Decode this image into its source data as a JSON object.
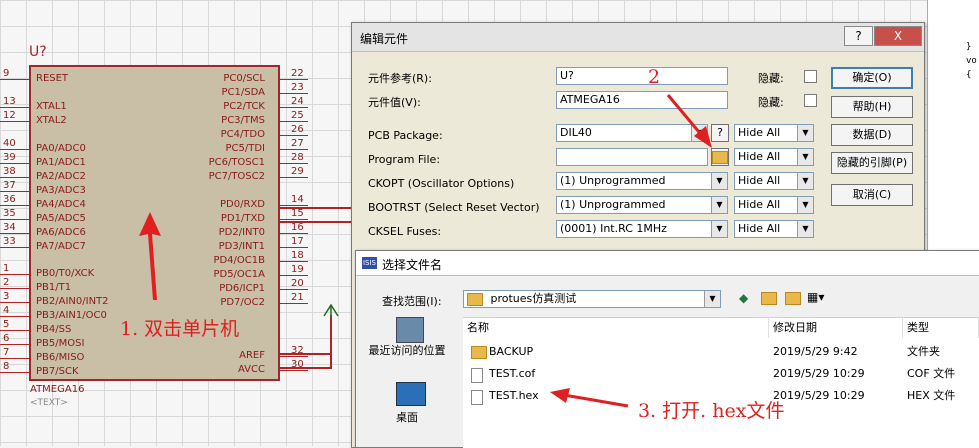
{
  "schematic": {
    "chip_ref": "U?",
    "chip_name": "ATMEGA16",
    "chip_text": "<TEXT>",
    "left_pins": [
      {
        "num": "9",
        "label": "RESET"
      },
      {
        "num": "13",
        "label": "XTAL1"
      },
      {
        "num": "12",
        "label": "XTAL2"
      },
      {
        "num": "40",
        "label": "PA0/ADC0"
      },
      {
        "num": "39",
        "label": "PA1/ADC1"
      },
      {
        "num": "38",
        "label": "PA2/ADC2"
      },
      {
        "num": "37",
        "label": "PA3/ADC3"
      },
      {
        "num": "36",
        "label": "PA4/ADC4"
      },
      {
        "num": "35",
        "label": "PA5/ADC5"
      },
      {
        "num": "34",
        "label": "PA6/ADC6"
      },
      {
        "num": "33",
        "label": "PA7/ADC7"
      },
      {
        "num": "1",
        "label": "PB0/T0/XCK"
      },
      {
        "num": "2",
        "label": "PB1/T1"
      },
      {
        "num": "3",
        "label": "PB2/AIN0/INT2"
      },
      {
        "num": "4",
        "label": "PB3/AIN1/OC0"
      },
      {
        "num": "5",
        "label": "PB4/SS"
      },
      {
        "num": "6",
        "label": "PB5/MOSI"
      },
      {
        "num": "7",
        "label": "PB6/MISO"
      },
      {
        "num": "8",
        "label": "PB7/SCK"
      }
    ],
    "right_pins": [
      {
        "num": "22",
        "label": "PC0/SCL"
      },
      {
        "num": "23",
        "label": "PC1/SDA"
      },
      {
        "num": "24",
        "label": "PC2/TCK"
      },
      {
        "num": "25",
        "label": "PC3/TMS"
      },
      {
        "num": "26",
        "label": "PC4/TDO"
      },
      {
        "num": "27",
        "label": "PC5/TDI"
      },
      {
        "num": "28",
        "label": "PC6/TOSC1"
      },
      {
        "num": "29",
        "label": "PC7/TOSC2"
      },
      {
        "num": "14",
        "label": "PD0/RXD"
      },
      {
        "num": "15",
        "label": "PD1/TXD"
      },
      {
        "num": "16",
        "label": "PD2/INT0"
      },
      {
        "num": "17",
        "label": "PD3/INT1"
      },
      {
        "num": "18",
        "label": "PD4/OC1B"
      },
      {
        "num": "19",
        "label": "PD5/OC1A"
      },
      {
        "num": "20",
        "label": "PD6/ICP1"
      },
      {
        "num": "21",
        "label": "PD7/OC2"
      },
      {
        "num": "32",
        "label": "AREF"
      },
      {
        "num": "30",
        "label": "AVCC"
      }
    ]
  },
  "annotations": {
    "step1": "1. 双击单片机",
    "step2": "2",
    "step3": "3. 打开. hex文件"
  },
  "edit_dialog": {
    "title": "编辑元件",
    "help_btn": "?",
    "close_btn": "X",
    "ref_label": "元件参考(R):",
    "ref_value": "U?",
    "value_label": "元件值(V):",
    "value_value": "ATMEGA16",
    "hidden_label1": "隐藏:",
    "hidden_label2": "隐藏:",
    "pcb_label": "PCB Package:",
    "pcb_value": "DIL40",
    "pcb_btn": "?",
    "program_label": "Program File:",
    "ckopt_label": "CKOPT (Oscillator Options)",
    "ckopt_value": "(1) Unprogrammed",
    "bootrst_label": "BOOTRST (Select Reset Vector)",
    "bootrst_value": "(1) Unprogrammed",
    "cksel_label": "CKSEL Fuses:",
    "cksel_value": "(0001) Int.RC 1MHz",
    "hide_all": "Hide All",
    "buttons": {
      "ok": "确定(O)",
      "help": "帮助(H)",
      "data": "数据(D)",
      "hidden_pins": "隐藏的引脚(P)",
      "cancel": "取消(C)"
    }
  },
  "file_dialog": {
    "app_icon": "ISIS",
    "title": "选择文件名",
    "lookin_label": "查找范围(I):",
    "lookin_value": "protues仿真测试",
    "places": [
      {
        "label": "最近访问的位置"
      },
      {
        "label": "桌面"
      }
    ],
    "columns": {
      "name": "名称",
      "modified": "修改日期",
      "type": "类型"
    },
    "files": [
      {
        "kind": "folder",
        "name": "BACKUP",
        "modified": "2019/5/29 9:42",
        "type": "文件夹"
      },
      {
        "kind": "file",
        "name": "TEST.cof",
        "modified": "2019/5/29 10:29",
        "type": "COF 文件"
      },
      {
        "kind": "file",
        "name": "TEST.hex",
        "modified": "2019/5/29 10:29",
        "type": "HEX 文件"
      }
    ]
  },
  "code_panel": {
    "lines": [
      "}",
      "vo",
      "{"
    ]
  },
  "colors": {
    "accent": "#e02020",
    "wire": "#b22222",
    "chip_fill": "#c8bfa6"
  }
}
